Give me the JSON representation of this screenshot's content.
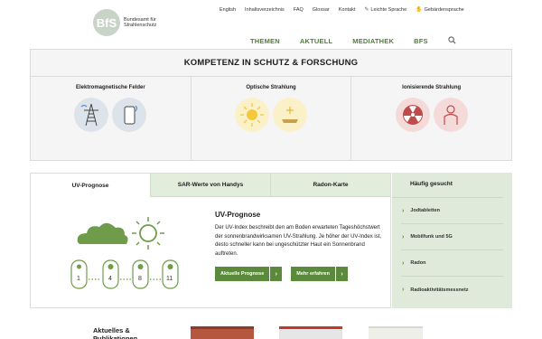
{
  "header": {
    "logo": {
      "mark": "BfS",
      "name": "Bundesamt für Strahlenschutz"
    },
    "meta_nav": [
      {
        "label": "English"
      },
      {
        "label": "Inhaltsverzeichnis"
      },
      {
        "label": "FAQ"
      },
      {
        "label": "Glossar"
      },
      {
        "label": "Kontakt"
      },
      {
        "label": "Leichte Sprache",
        "icon": "easy-language-icon"
      },
      {
        "label": "Gebärdensprache",
        "icon": "sign-language-icon"
      }
    ],
    "main_nav": [
      "THEMEN",
      "AKTUELL",
      "MEDIATHEK",
      "BFS"
    ],
    "search_icon": "search-icon"
  },
  "kompetenz": {
    "title": "KOMPETENZ IN SCHUTZ & FORSCHUNG",
    "columns": [
      {
        "label": "Elektromagnetische Felder",
        "icons": [
          "power-pylon-icon",
          "mobile-phone-icon"
        ]
      },
      {
        "label": "Optische Strahlung",
        "icons": [
          "sun-icon",
          "sunbed-icon"
        ]
      },
      {
        "label": "Ionisierende Strahlung",
        "icons": [
          "radiation-icon",
          "patient-icon"
        ]
      }
    ]
  },
  "tabs": [
    "UV-Prognose",
    "SAR-Werte von Handys",
    "Radon-Karte"
  ],
  "uv": {
    "title": "UV-Prognose",
    "description": "Der UV-Index beschreibt den am Boden erwarteten Tageshöchstwert der sonnenbrandwirksamen UV-Strahlung. Je höher der UV-Index ist, desto schneller kann bei ungeschützter Haut ein Sonnenbrand auftreten.",
    "index_values": [
      "1",
      "4",
      "8",
      "11"
    ],
    "buttons": [
      "Aktuelle Prognose",
      "Mehr erfahren"
    ]
  },
  "haeufig": {
    "title": "Häufig gesucht",
    "items": [
      "Jodtabletten",
      "Mobilfunk und 5G",
      "Radon",
      "Radioaktivitätsmessnetz"
    ]
  },
  "aktuelles": {
    "title": "Aktuelles & Publikationen"
  },
  "colors": {
    "accent": "#5b8a3c",
    "tab_bg": "#e3eddc",
    "sidebar_bg": "#dfeadb"
  }
}
